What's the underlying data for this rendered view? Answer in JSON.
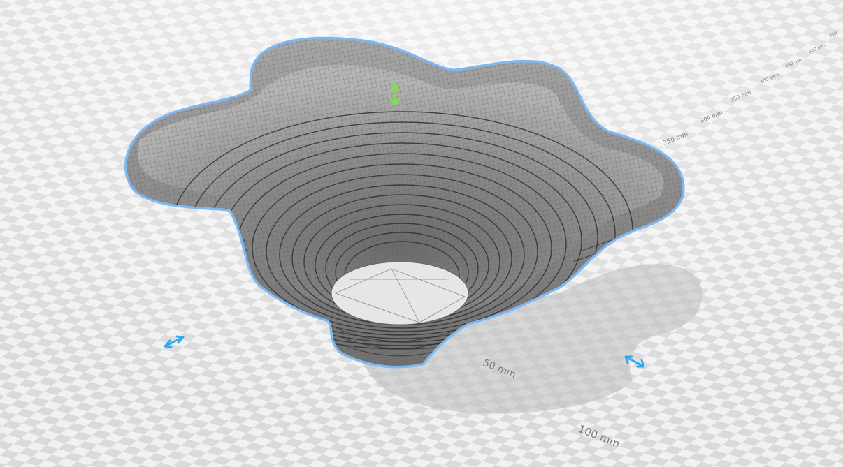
{
  "viewer": {
    "scale_labels": [
      "50 mm",
      "100 mm",
      "250 mm",
      "300 mm",
      "350 mm",
      "400 mm",
      "450 mm",
      "500 mm",
      "550"
    ],
    "colors": {
      "floor_light": "#f1f1f1",
      "floor_dark": "#d9d9d9",
      "mesh_fill": "#9c9c9c",
      "mesh_line": "#3a3a3a",
      "selection_outline": "#7fb8f0",
      "scale_handle": "#33aaf0",
      "move_handle": "#7ee04a",
      "shadow": "#bdbdbd"
    },
    "icons": {
      "scale_handle": "double-arrow-icon",
      "move_handle": "vertical-double-arrow-icon"
    }
  }
}
